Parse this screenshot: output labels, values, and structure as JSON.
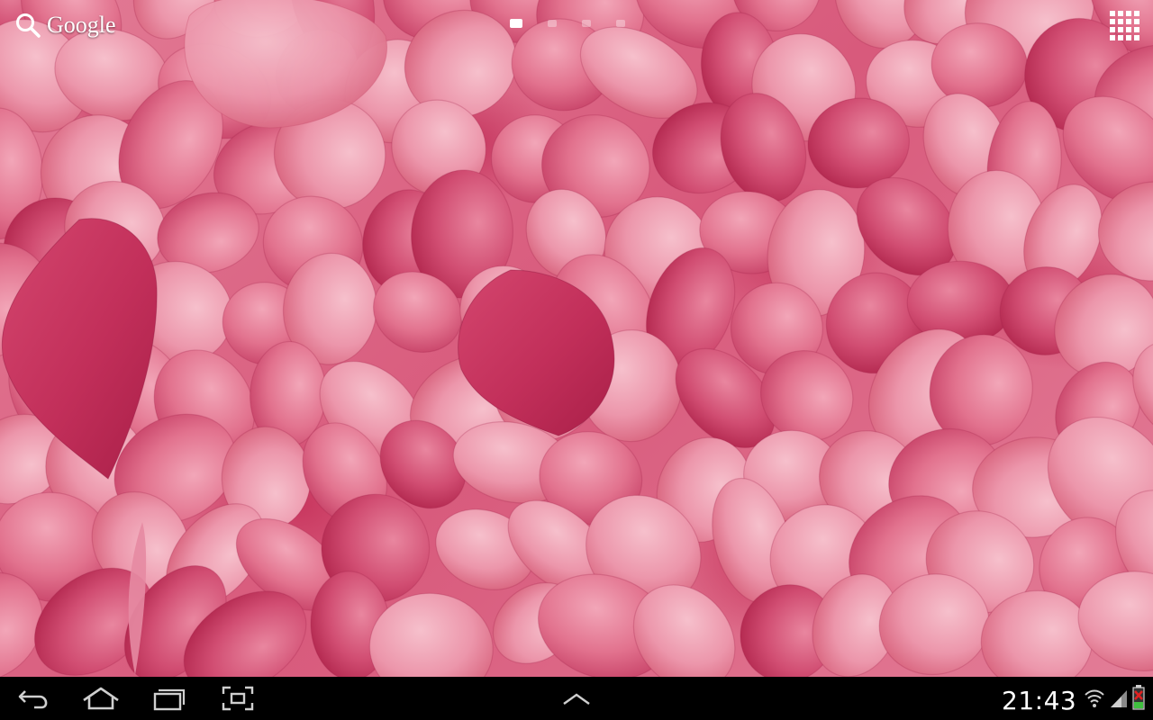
{
  "search": {
    "label": "Google",
    "icon": "search-icon"
  },
  "home_pages": {
    "count": 4,
    "active_index": 0
  },
  "apps_button": {
    "icon": "apps-grid-icon"
  },
  "navigation": {
    "back_icon": "back-icon",
    "home_icon": "home-icon",
    "recents_icon": "recent-apps-icon",
    "screenshot_icon": "screenshot-icon",
    "menu_icon": "chevron-up-icon"
  },
  "status": {
    "time": "21:43",
    "wifi_icon": "wifi-icon",
    "signal_icon": "signal-icon",
    "battery_icon": "battery-alert-icon"
  },
  "colors": {
    "petal_light": "#f0a3b5",
    "petal_mid": "#e4748f",
    "petal_dark": "#c42c57",
    "system_bar": "#000000"
  }
}
